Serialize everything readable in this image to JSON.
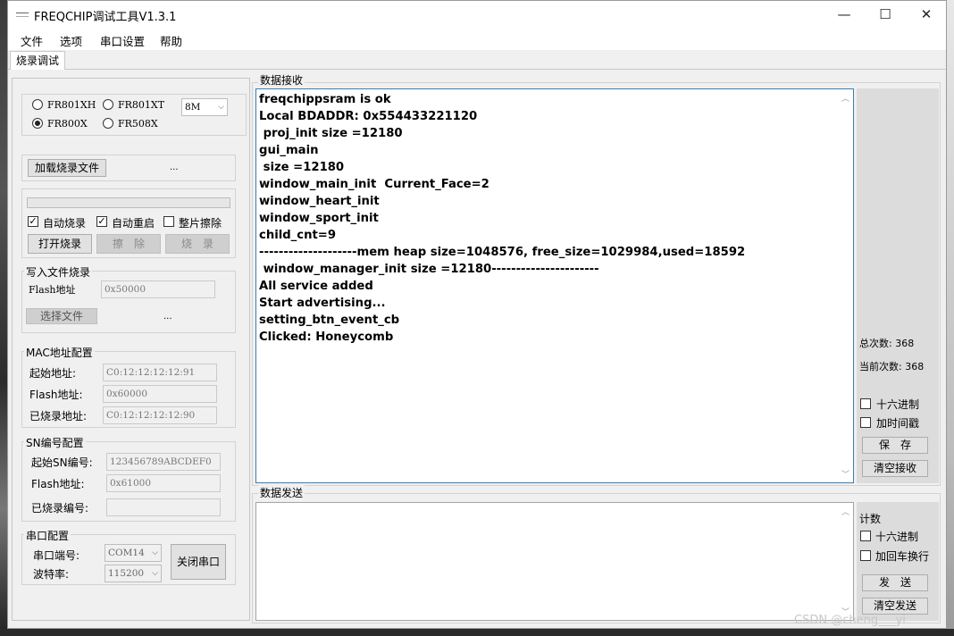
{
  "window": {
    "title": "FREQCHIP调试工具V1.3.1",
    "minimize": "—",
    "maximize": "☐",
    "close": "✕"
  },
  "menu": [
    "文件",
    "选项",
    "串口设置",
    "帮助"
  ],
  "tab": "烧录调试",
  "chip": {
    "options": [
      "FR801XH",
      "FR801XT",
      "FR800X",
      "FR508X"
    ],
    "selected": "FR800X",
    "flash_size": "8M"
  },
  "load": {
    "button": "加载烧录文件",
    "path": "..."
  },
  "burn": {
    "auto_burn": "自动烧录",
    "auto_restart": "自动重启",
    "full_erase": "整片擦除",
    "open_burn": "打开烧录",
    "erase": "擦　除",
    "burn": "烧　录"
  },
  "write_file": {
    "group": "写入文件烧录",
    "flash_label": "Flash地址",
    "flash_value": "0x50000",
    "select_button": "选择文件",
    "path": "..."
  },
  "mac": {
    "group": "MAC地址配置",
    "start_label": "起始地址:",
    "start_value": "C0:12:12:12:12:91",
    "flash_label": "Flash地址:",
    "flash_value": "0x60000",
    "burned_label": "已烧录地址:",
    "burned_value": "C0:12:12:12:12:90"
  },
  "sn": {
    "group": "SN编号配置",
    "start_label": "起始SN编号:",
    "start_value": "123456789ABCDEF0",
    "flash_label": "Flash地址:",
    "flash_value": "0x61000",
    "burned_label": "已烧录编号:",
    "burned_value": ""
  },
  "serial": {
    "group": "串口配置",
    "port_label": "串口端号:",
    "port_value": "COM14",
    "baud_label": "波特率:",
    "baud_value": "115200",
    "close_button": "关闭串口"
  },
  "receive": {
    "group": "数据接收",
    "lines": [
      "freqchippsram is ok",
      "Local BDADDR: 0x554433221120",
      " proj_init size =12180",
      "gui_main",
      " size =12180",
      "window_main_init  Current_Face=2",
      "window_heart_init",
      "window_sport_init",
      "child_cnt=9",
      "--------------------mem heap size=1048576, free_size=1029984,used=18592",
      " window_manager_init size =12180----------------------",
      "All service added",
      "Start advertising...",
      "setting_btn_event_cb",
      "Clicked: Honeycomb"
    ],
    "total_count": "总次数: 368",
    "current_count": "当前次数: 368",
    "hex": "十六进制",
    "timestamp": "加时间戳",
    "save": "保　存",
    "clear": "清空接收"
  },
  "send": {
    "group": "数据发送",
    "count": "计数",
    "hex": "十六进制",
    "crlf": "加回车换行",
    "send": "发　送",
    "clear": "清空发送"
  },
  "watermark": "CSDN @cheng___yi"
}
